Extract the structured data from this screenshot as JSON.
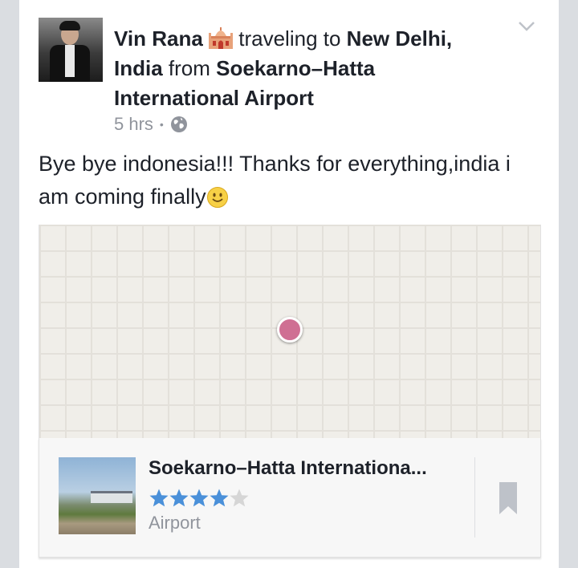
{
  "post": {
    "author": "Vin Rana",
    "activity": "traveling to",
    "destination": "New Delhi, India",
    "from_word": "from",
    "origin": "Soekarno–Hatta International Airport",
    "time": "5 hrs",
    "separator": "•",
    "text": "Bye bye indonesia!!! Thanks for everything,india i am coming finally"
  },
  "place": {
    "title": "Soekarno–Hatta Internationa...",
    "rating": 4,
    "rating_max": 5,
    "category": "Airport"
  },
  "icons": {
    "activity": "taj-mahal-icon",
    "privacy": "globe-icon",
    "menu": "chevron-down-icon",
    "emoji": "smile-icon",
    "save": "bookmark-icon"
  },
  "colors": {
    "star_filled": "#4a90d9",
    "star_empty": "#d6d6d6",
    "pin": "#cf6f93",
    "text": "#1d2129",
    "muted": "#90949c"
  }
}
